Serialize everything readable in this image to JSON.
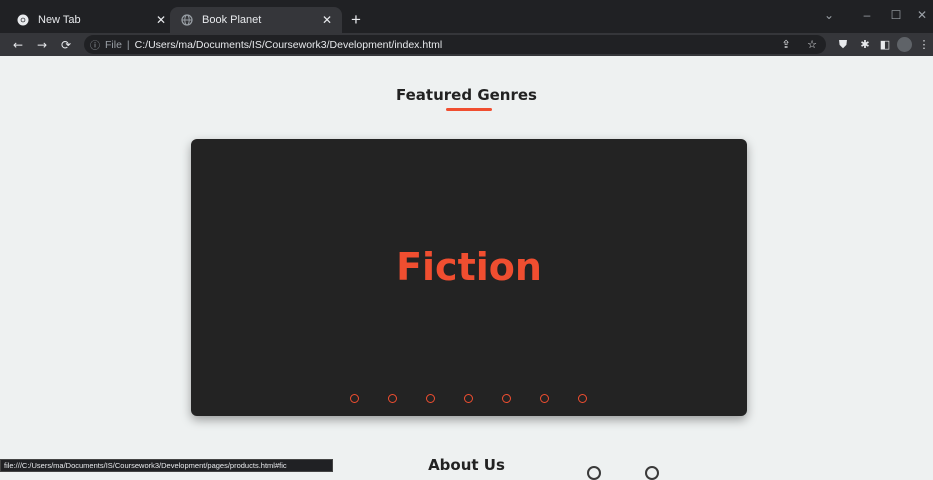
{
  "browser": {
    "tabs": [
      {
        "title": "New Tab",
        "icon": "chrome-icon",
        "active": false
      },
      {
        "title": "Book Planet",
        "icon": "globe-icon",
        "active": true
      }
    ],
    "url_scheme": "File",
    "url_path": "C:/Users/ma/Documents/IS/Coursework3/Development/index.html",
    "status_url": "file:///C:/Users/ma/Documents/IS/Coursework3/Development/pages/products.html#fic"
  },
  "page": {
    "featured_heading": "Featured Genres",
    "carousel": {
      "current_genre": "Fiction",
      "slide_count": 7
    },
    "about_heading": "About Us"
  },
  "colors": {
    "accent": "#f04e30",
    "card": "#232323",
    "background": "#eef1f1"
  }
}
